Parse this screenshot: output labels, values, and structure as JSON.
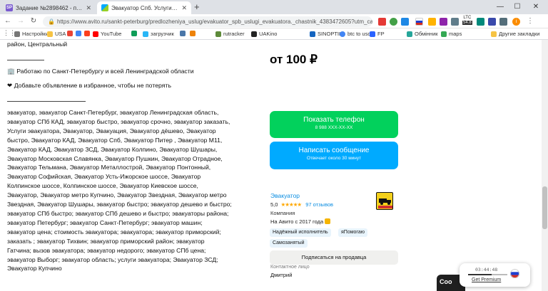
{
  "browser": {
    "tabs": [
      {
        "icon": "sp-favicon",
        "icon_text": "SP",
        "title": "Задание №2898462 - просмотр з",
        "active": false
      },
      {
        "icon": "avito-favicon",
        "title": "Эвакуатор Спб. Услуги эвакуатор",
        "active": true
      }
    ],
    "new_tab": "+",
    "url": "https://www.avito.ru/sankt-peterburg/predlozheniya_uslug/evakuator_spb_uslugi_evakuatora._chastnik_4383472605?utm_cam...",
    "weather": {
      "label": "LTC",
      "value": "54.8"
    },
    "profile_initial": "i"
  },
  "bookmarks": [
    {
      "label": "Настройки",
      "icon": "gear-icon"
    },
    {
      "label": "USA",
      "icon": "flag-usa-icon"
    },
    {
      "label": "",
      "icon": "gmail-icon"
    },
    {
      "label": "",
      "icon": "translate-icon"
    },
    {
      "label": "",
      "icon": "yandex-icon"
    },
    {
      "label": "YouTube",
      "icon": "youtube-icon"
    },
    {
      "label": "",
      "icon": "drive-icon"
    },
    {
      "label": "загрузчик",
      "icon": "download-icon"
    },
    {
      "label": "",
      "icon": "vk-icon"
    },
    {
      "label": "",
      "icon": "ok-icon"
    },
    {
      "label": "rutracker",
      "icon": "rutracker-icon"
    },
    {
      "label": "UAKino",
      "icon": "film-icon"
    },
    {
      "label": "SINOPTIK",
      "icon": "weather-icon"
    },
    {
      "label": "btc to usd",
      "icon": "google-icon"
    },
    {
      "label": "FP",
      "icon": "fp-icon"
    },
    {
      "label": "Обмінник",
      "icon": "exchange-icon"
    },
    {
      "label": "maps",
      "icon": "maps-icon"
    },
    {
      "label": "Другие закладки",
      "icon": "folder-icon"
    }
  ],
  "listing": {
    "location_line": "район, Центральный",
    "service_line": "🏢 Работаю по Санкт-Петербургу и всей Ленинградской области",
    "favorite_line": "❤ Добавьте объявление в избранное, чтобы не потерять",
    "description_lines": [
      "эвакуатор, эвакуатор Санкт-Петербург, эвакуатор Ленинградская область,",
      "эвакуатор СПб КАД, эвакуатор быстро, эвакуатор срочно, эвакуатор заказать,",
      "Услуги эвакуатора, Эвакуатор, Эвакуация, Эвакуатор дёшево, Эвакуатор",
      "быстро, Эвакуатор КАД, Эвакуатор Спб, Эвакуатор Питер , Эвакуатор М11,",
      "Эвакуатор КАД, Эвакуатор ЗСД, Эвакуатор Колпино, Эвакуатор Шушары,",
      "Эвакуатор Московская Славянка, Эвакуатор Пушкин, Эвакуатор Отрадное,",
      "Эвакуатор Тельмана, Эвакуатор Металлострой, Эвакуатор Понтонный,",
      "Эвакуатор Софийская, Эвакуатор Усть-Ижорское шоссе, Эвакуатор",
      "Колпинское шоссе, Колпинское шоссе, Эвакуатор Киевское шоссе,",
      "Эвакуатор, Эвакуатор метро Купчино, Эвакуатор Звездная, Эвакуатор метро",
      "Звездная, Эвакуатор Шушары, эвакуатор быстро; эвакуатор дешево и быстро;",
      "эвакуатор СПб быстро; эвакуатор СПб дешево и быстро; эвакуаторы района;",
      "эвакуатор Петербург; эвакуатор Санкт-Петербург; эвакуатор машин;",
      "эвакуатор цена; стоимость эвакуатора; эвакуатора; эвакуатор приморский;",
      "заказать ; эвакуатор Тихвин; эвакуатор приморский район; эвакуатор",
      "Гатчина; вызов эвакуатора; эвакуатор недорого; эвакуатор СПб цена;",
      "эвакуатор Выборг; эвакуатор область; услуги эвакуатора; Эвакуатор ЗСД;",
      "Эвакуатор Купчино"
    ]
  },
  "sidebar": {
    "price": "от 100 ₽",
    "phone_button": {
      "label": "Показать телефон",
      "sub": "8 988 XXX-XX-XX"
    },
    "message_button": {
      "label": "Написать сообщение",
      "sub": "Отвечает около 30 минут"
    },
    "seller": {
      "name": "Эвакуатор",
      "rating": "5,0",
      "stars": "★★★★★",
      "stars_value": 5,
      "reviews": "97 отзывов",
      "type": "Компания",
      "since": "На Авито с 2017 года",
      "badges": [
        "Надёжный исполнитель",
        "яПомогаю",
        "Самозанятый"
      ],
      "logo_text": "ЭВАКУАТОР"
    },
    "subscribe_button": "Подписаться на продавца",
    "contact_label": "Контактное лицо",
    "contact_name": "Дмитрий"
  },
  "vpn_widget": {
    "time": "03:44:48",
    "progress": 0.6,
    "premium_link": "Get Premium"
  },
  "chat_bar": {
    "label": "Соо"
  },
  "colors": {
    "green": "#02d15c",
    "blue": "#00aaff",
    "link": "#0a8de1",
    "star": "#ffa800"
  }
}
